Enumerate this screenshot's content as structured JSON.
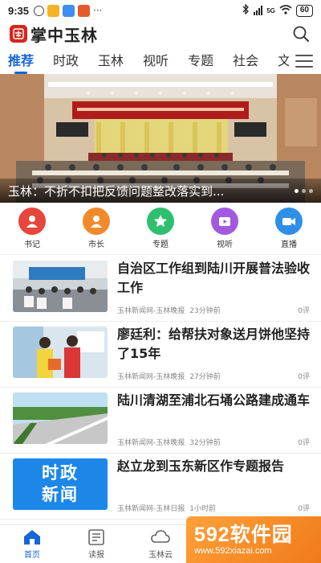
{
  "status_bar": {
    "time": "9:35",
    "signal_text": "5G",
    "battery": "60"
  },
  "app": {
    "title": "掌中玉林"
  },
  "tabs": [
    {
      "label": "推荐",
      "active": true
    },
    {
      "label": "时政"
    },
    {
      "label": "玉林"
    },
    {
      "label": "视听"
    },
    {
      "label": "专题"
    },
    {
      "label": "社会"
    },
    {
      "label": "文"
    }
  ],
  "banner": {
    "caption": "玉林：不折不扣把反馈问题整改落实到..."
  },
  "quick_nav": [
    {
      "label": "书记",
      "color": "#e8453c",
      "icon": "person-icon"
    },
    {
      "label": "市长",
      "color": "#f28a2c",
      "icon": "person-icon"
    },
    {
      "label": "专题",
      "color": "#2fbf71",
      "icon": "star-icon"
    },
    {
      "label": "视听",
      "color": "#a259e0",
      "icon": "video-icon"
    },
    {
      "label": "直播",
      "color": "#2f8fe6",
      "icon": "camera-icon"
    }
  ],
  "news": [
    {
      "title": "自治区工作组到陆川开展普法验收工作",
      "source": "玉林新闻网-玉林晚报",
      "time": "23分钟前",
      "comments": "0评"
    },
    {
      "title": "廖廷利：给帮扶对象送月饼他坚持了15年",
      "source": "玉林新闻网-玉林晚报",
      "time": "27分钟前",
      "comments": "0评"
    },
    {
      "title": "陆川清湖至浦北石埇公路建成通车",
      "source": "玉林新闻网-玉林晚报",
      "time": "32分钟前",
      "comments": "0评"
    },
    {
      "title": "赵立龙到玉东新区作专题报告",
      "source": "玉林新闻网-玉林日报",
      "time": "1小时前",
      "comments": "0评",
      "thumb_text_1": "时政",
      "thumb_text_2": "新闻"
    }
  ],
  "bottom_nav": [
    {
      "label": "首页",
      "active": true
    },
    {
      "label": "读报"
    },
    {
      "label": "玉林云"
    }
  ],
  "watermark": {
    "big": "592软件园",
    "small": "www.592xiazai.com"
  }
}
